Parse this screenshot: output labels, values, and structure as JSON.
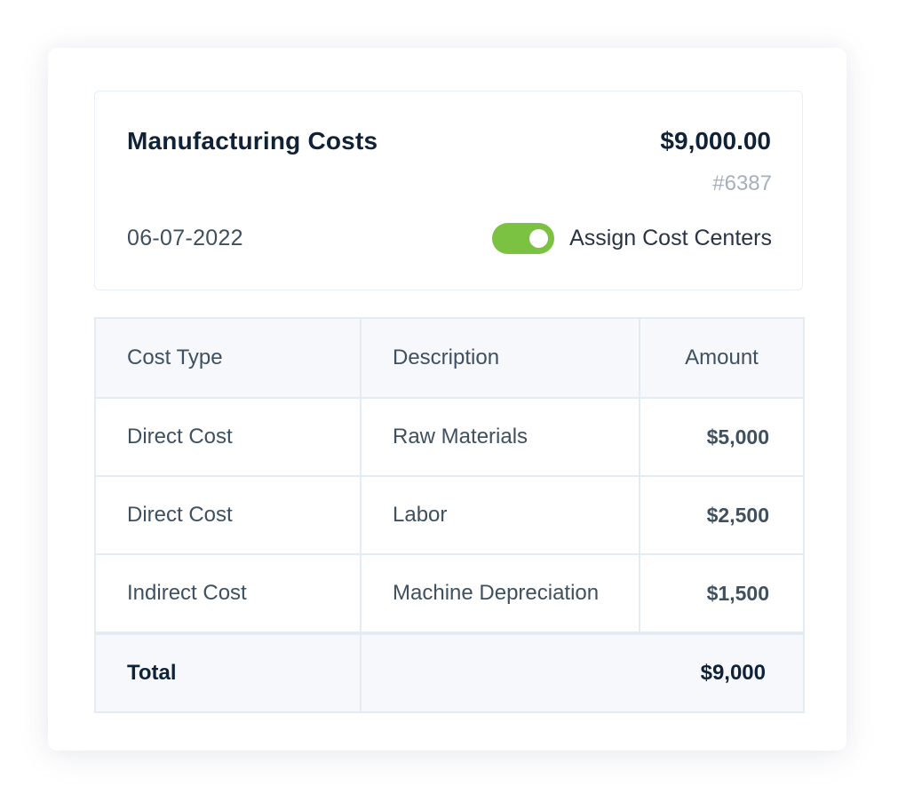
{
  "summary": {
    "title": "Manufacturing Costs",
    "amount": "$9,000.00",
    "reference": "#6387",
    "date": "06-07-2022",
    "toggle": {
      "label": "Assign Cost Centers",
      "checked": true,
      "color": "#7cc242"
    }
  },
  "table": {
    "columns": [
      "Cost Type",
      "Description",
      "Amount"
    ],
    "rows": [
      {
        "cost_type": "Direct Cost",
        "description": "Raw Materials",
        "amount": "$5,000"
      },
      {
        "cost_type": "Direct Cost",
        "description": "Labor",
        "amount": "$2,500"
      },
      {
        "cost_type": "Indirect Cost",
        "description": "Machine Depreciation",
        "amount": "$1,500"
      }
    ],
    "total": {
      "label": "Total",
      "amount": "$9,000"
    }
  }
}
